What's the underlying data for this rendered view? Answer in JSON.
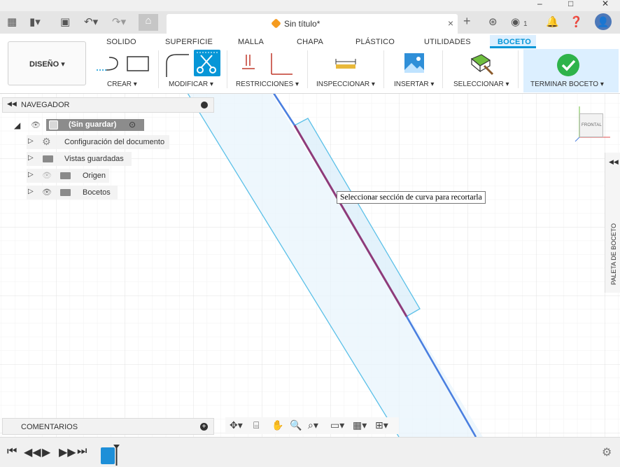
{
  "window": {
    "minimize": "–",
    "maximize": "□",
    "close": "✕"
  },
  "document": {
    "title": "Sin título*",
    "close": "×"
  },
  "appbar": {
    "notifications_count": "1"
  },
  "ribbon": {
    "tabs": [
      "SOLIDO",
      "SUPERFICIE",
      "MALLA",
      "CHAPA",
      "PLÁSTICO",
      "UTILIDADES",
      "BOCETO"
    ],
    "active_tab": "BOCETO",
    "workspace": "DISEÑO ▾",
    "groups": [
      "CREAR ▾",
      "MODIFICAR ▾",
      "RESTRICCIONES ▾",
      "INSPECCIONAR ▾",
      "INSERTAR ▾",
      "SELECCIONAR ▾",
      "TERMINAR BOCETO ▾"
    ]
  },
  "browser": {
    "title": "NAVEGADOR",
    "root": "(Sin guardar)",
    "items": [
      "Configuración del documento",
      "Vistas guardadas",
      "Origen",
      "Bocetos"
    ]
  },
  "tooltip": "Seleccionar sección de curva para recortarla",
  "viewcube": {
    "face": "FRONTAL"
  },
  "palette": {
    "label": "PALETA DE BOCETO"
  },
  "comments": {
    "title": "COMENTARIOS"
  },
  "colors": {
    "accent": "#0696d7",
    "sketch_line": "#4a7fe0",
    "selected_curve": "#8e3b7a",
    "profile_fill": "#e8f4fc",
    "profile_stroke": "#5bc0e8",
    "finish_check": "#2eb34a"
  }
}
